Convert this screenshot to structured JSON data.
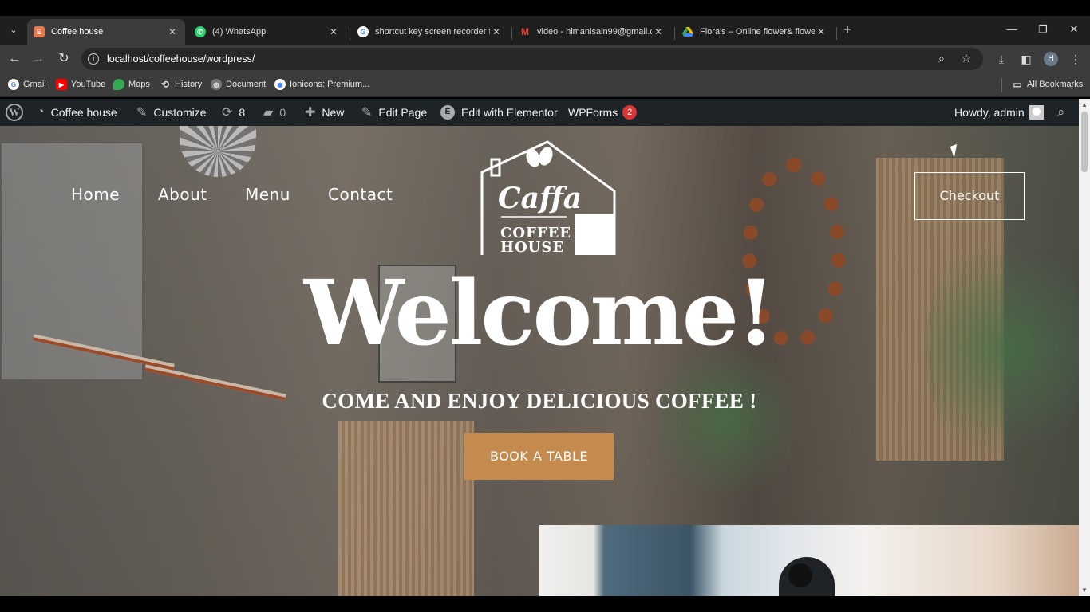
{
  "browser": {
    "tabs": [
      {
        "title": "Coffee house",
        "icon": "elementor-favicon",
        "color": "#f0764a"
      },
      {
        "title": "(4) WhatsApp",
        "icon": "whatsapp-favicon",
        "color": "#25d366"
      },
      {
        "title": "shortcut key screen recorder fo",
        "icon": "google-favicon",
        "color": "#4285f4"
      },
      {
        "title": "video - himanisain99@gmail.co",
        "icon": "gmail-favicon",
        "color": "#ea4335"
      },
      {
        "title": "Flora's – Online flower& flower",
        "icon": "drive-favicon",
        "color": "#34a853"
      }
    ],
    "url": "localhost/coffeehouse/wordpress/",
    "profile_initial": "H",
    "bookmarks": [
      {
        "label": "Gmail"
      },
      {
        "label": "YouTube"
      },
      {
        "label": "Maps"
      },
      {
        "label": "History"
      },
      {
        "label": "Document"
      },
      {
        "label": "Ionicons: Premium..."
      }
    ],
    "all_bookmarks": "All Bookmarks"
  },
  "adminbar": {
    "site": "Coffee house",
    "customize": "Customize",
    "updates": "8",
    "comments": "0",
    "new": "New",
    "edit_page": "Edit Page",
    "elementor": "Edit with Elementor",
    "wpforms": "WPForms",
    "wpforms_badge": "2",
    "howdy": "Howdy, admin"
  },
  "site": {
    "nav": [
      "Home",
      "About",
      "Menu",
      "Contact"
    ],
    "checkout": "Checkout",
    "logo": {
      "brand": "Caffa",
      "line1": "COFFEE",
      "line2": "HOUSE"
    },
    "welcome": "Welcome!",
    "tagline": "COME AND ENJOY DELICIOUS COFFEE !",
    "cta": "BOOK A TABLE",
    "accent_color": "#c48a4e"
  }
}
